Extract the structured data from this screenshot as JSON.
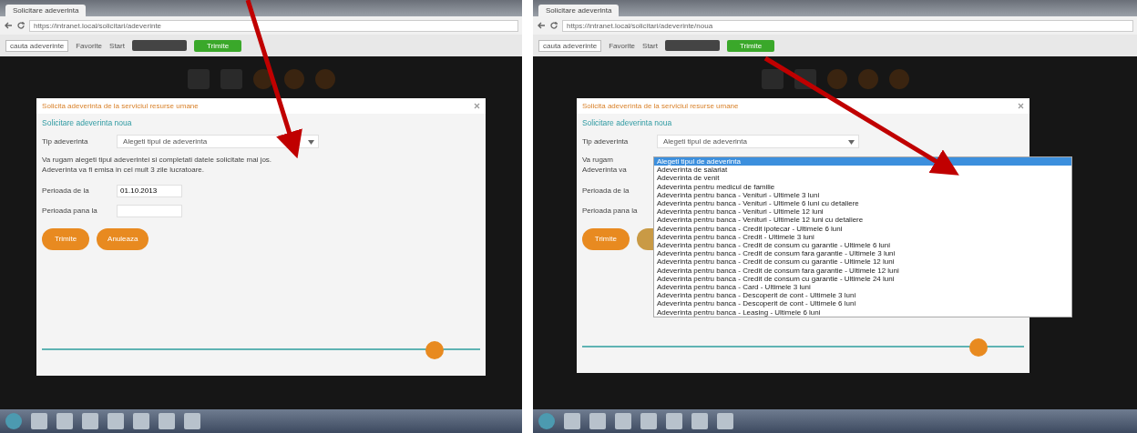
{
  "windows": [
    {
      "tab": "Solicitare adeverinta",
      "url": "https://intranet.local/solicitari/adeverinte",
      "bookmark_search": "cauta adeverinte",
      "bookmark_links": [
        "Favorite",
        "Start"
      ],
      "green_button": "Trimite",
      "modal": {
        "title": "Solicita adeverinta de la serviciul resurse umane",
        "subtitle": "Solicitare adeverinta noua",
        "type_label": "Tip adeverinta",
        "type_value": "Alegeti tipul de adeverinta",
        "note_lines": [
          "Va rugam alegeti tipul adeverintei si completati datele solicitate mai jos.",
          "Adeverinta va fi emisa in cel mult 3 zile lucratoare."
        ],
        "date_from_label": "Perioada de la",
        "date_from_value": "01.10.2013",
        "date_to_label": "Perioada pana la",
        "buttons": [
          {
            "label": "Trimite"
          },
          {
            "label": "Anuleaza"
          }
        ]
      }
    },
    {
      "tab": "Solicitare adeverinta",
      "url": "https://intranet.local/solicitari/adeverinte/noua",
      "bookmark_search": "cauta adeverinte",
      "bookmark_links": [
        "Favorite",
        "Start"
      ],
      "green_button": "Trimite",
      "modal": {
        "title": "Solicita adeverinta de la serviciul resurse umane",
        "subtitle": "Solicitare adeverinta noua",
        "type_label": "Tip adeverinta",
        "type_value": "Alegeti tipul de adeverinta",
        "note_lines": [
          "Va rugam",
          "Adeverinta va"
        ],
        "date_from_label": "Perioada de la",
        "date_to_label": "Perioada pana la",
        "buttons": [
          {
            "label": "Trimite"
          },
          {
            "covered": true
          }
        ],
        "options": [
          {
            "label": "Alegeti tipul de adeverinta",
            "selected": true
          },
          {
            "label": "Adeverinta de salariat",
            "selected": false
          },
          {
            "label": "Adeverinta de venit",
            "selected": false
          },
          {
            "label": "Adeverinta pentru medicul de familie",
            "selected": false
          },
          {
            "label": "Adeverinta pentru banca - Venituri - Ultimele 3 luni",
            "selected": false
          },
          {
            "label": "Adeverinta pentru banca - Venituri - Ultimele 6 luni cu detaliere",
            "selected": false
          },
          {
            "label": "Adeverinta pentru banca - Venituri - Ultimele 12 luni",
            "selected": false
          },
          {
            "label": "Adeverinta pentru banca - Venituri - Ultimele 12 luni cu detaliere",
            "selected": false
          },
          {
            "label": "Adeverinta pentru banca - Credit ipotecar - Ultimele 6 luni",
            "selected": false
          },
          {
            "label": "Adeverinta pentru banca - Credit - Ultimele 3 luni",
            "selected": false
          },
          {
            "label": "Adeverinta pentru banca - Credit de consum cu garantie - Ultimele 6 luni",
            "selected": false
          },
          {
            "label": "Adeverinta pentru banca - Credit de consum fara garantie - Ultimele 3 luni",
            "selected": false
          },
          {
            "label": "Adeverinta pentru banca - Credit de consum cu garantie - Ultimele 12 luni",
            "selected": false
          },
          {
            "label": "Adeverinta pentru banca - Credit de consum fara garantie - Ultimele 12 luni",
            "selected": false
          },
          {
            "label": "Adeverinta pentru banca - Credit de consum cu garantie - Ultimele 24 luni",
            "selected": false
          },
          {
            "label": "Adeverinta pentru banca - Card - Ultimele 3 luni",
            "selected": false
          },
          {
            "label": "Adeverinta pentru banca - Descoperit de cont - Ultimele 3 luni",
            "selected": false
          },
          {
            "label": "Adeverinta pentru banca - Descoperit de cont - Ultimele 6 luni",
            "selected": false
          },
          {
            "label": "Adeverinta pentru banca - Leasing - Ultimele 6 luni",
            "selected": false
          }
        ]
      }
    }
  ]
}
